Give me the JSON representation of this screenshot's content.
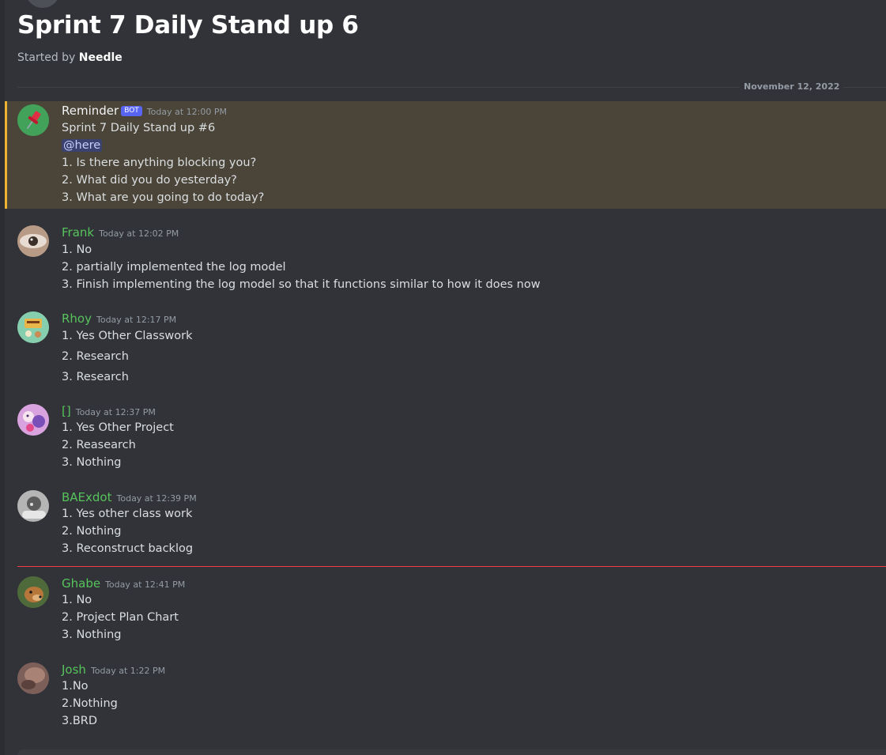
{
  "thread": {
    "title": "Sprint 7 Daily Stand up 6",
    "started_by_prefix": "Started by ",
    "started_by_name": "Needle"
  },
  "date_divider": "November 12, 2022",
  "messages": [
    {
      "username": "Reminder",
      "bot_tag": "BOT",
      "timestamp": "Today at 12:00 PM",
      "lines": [
        "Sprint 7 Daily Stand up #6",
        "@here",
        "1. Is there anything blocking you?",
        "2. What did you do yesterday?",
        "3. What are you going to do today?"
      ],
      "avatar_icon": "pushpin-icon"
    },
    {
      "username": "Frank",
      "timestamp": "Today at 12:02 PM",
      "lines": [
        "1. No",
        "2. partially implemented the log model",
        "3. Finish implementing the log model so that it functions similar to how it does now"
      ]
    },
    {
      "username": "Rhoy",
      "timestamp": "Today at 12:17 PM",
      "lines": [
        "1. Yes Other Classwork",
        "2. Research",
        "3. Research"
      ]
    },
    {
      "username": "[]",
      "timestamp": "Today at 12:37 PM",
      "lines": [
        "1. Yes Other Project",
        "2. Reasearch",
        "3. Nothing"
      ]
    },
    {
      "username": "BAExdot",
      "timestamp": "Today at 12:39 PM",
      "lines": [
        "1. Yes other class work",
        "2. Nothing",
        "3. Reconstruct backlog"
      ]
    },
    {
      "username": "Ghabe",
      "timestamp": "Today at 12:41 PM",
      "lines": [
        "1. No",
        "2. Project Plan Chart",
        "3. Nothing"
      ]
    },
    {
      "username": "Josh",
      "timestamp": "Today at 1:22 PM",
      "lines": [
        "1.No",
        "2.Nothing",
        "3.BRD"
      ]
    }
  ],
  "colors": {
    "background": "#313338",
    "username_green": "#57c35b",
    "mention_highlight": "#4a4538",
    "mention_border": "#f0b232",
    "new_messages_line": "#f23f43",
    "bot_tag": "#5865f2"
  }
}
